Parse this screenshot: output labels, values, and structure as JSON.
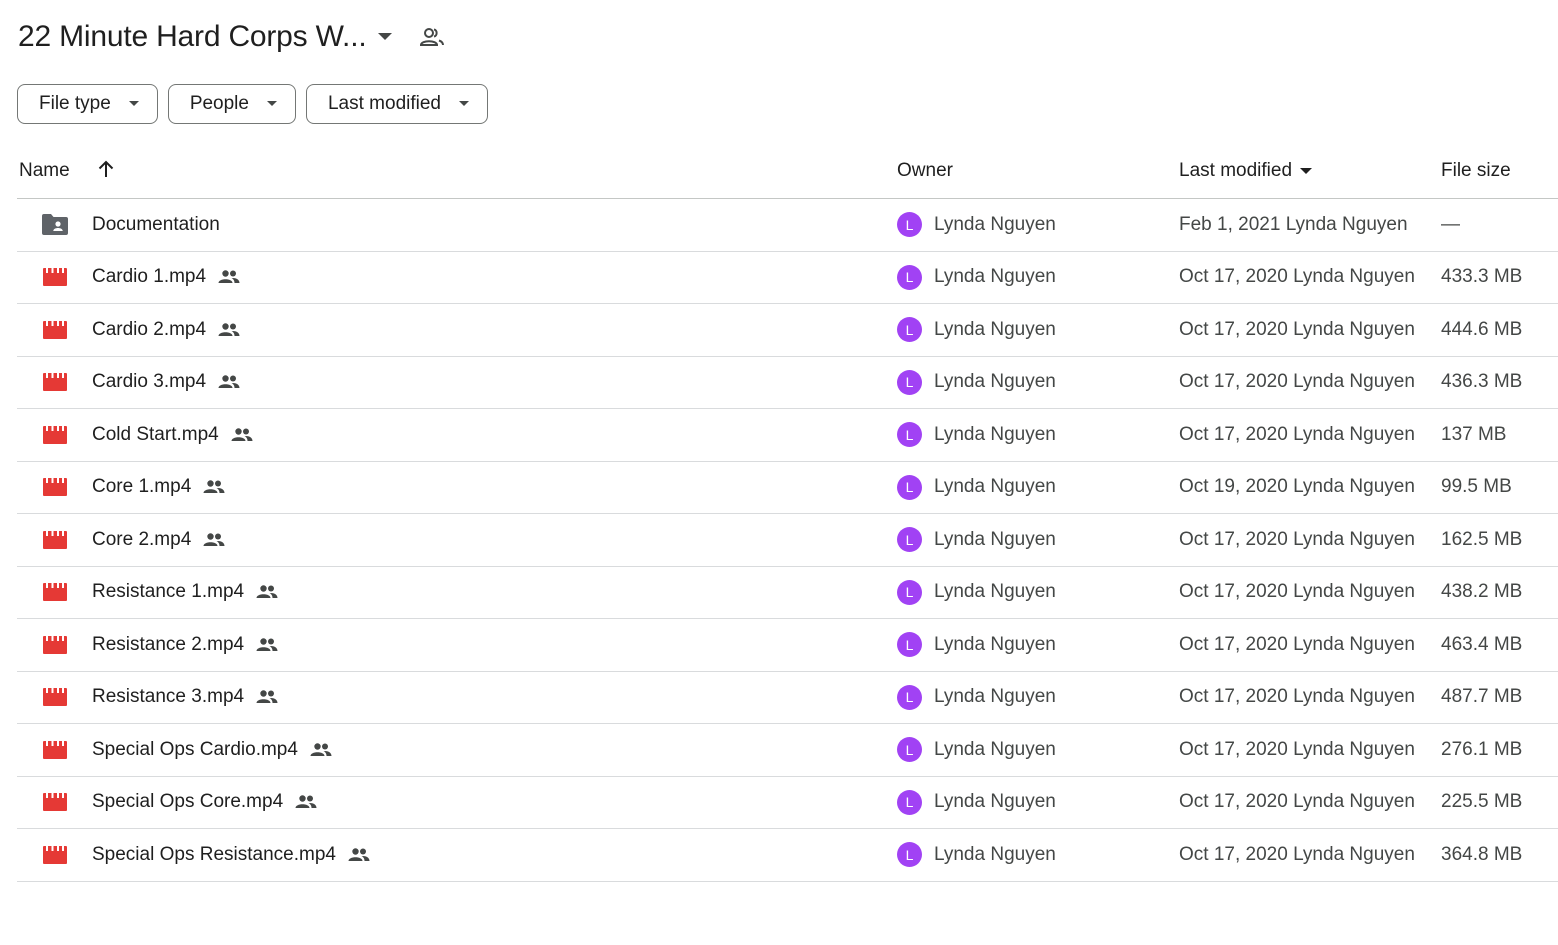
{
  "header": {
    "title": "22 Minute Hard Corps W..."
  },
  "filters": [
    {
      "label": "File type"
    },
    {
      "label": "People"
    },
    {
      "label": "Last modified"
    }
  ],
  "columns": {
    "name": "Name",
    "owner": "Owner",
    "last_modified": "Last modified",
    "file_size": "File size"
  },
  "colors": {
    "video_icon": "#e53935",
    "folder_icon": "#5f6368",
    "avatar": "#a142f4",
    "border": "#747775"
  },
  "files": [
    {
      "name": "Documentation",
      "type": "shared-folder",
      "shared": false,
      "owner": "Lynda Nguyen",
      "owner_initial": "L",
      "modified": "Feb 1, 2021 Lynda Nguyen",
      "size": "—"
    },
    {
      "name": "Cardio 1.mp4",
      "type": "video",
      "shared": true,
      "owner": "Lynda Nguyen",
      "owner_initial": "L",
      "modified": "Oct 17, 2020 Lynda Nguyen",
      "size": "433.3 MB"
    },
    {
      "name": "Cardio 2.mp4",
      "type": "video",
      "shared": true,
      "owner": "Lynda Nguyen",
      "owner_initial": "L",
      "modified": "Oct 17, 2020 Lynda Nguyen",
      "size": "444.6 MB"
    },
    {
      "name": "Cardio 3.mp4",
      "type": "video",
      "shared": true,
      "owner": "Lynda Nguyen",
      "owner_initial": "L",
      "modified": "Oct 17, 2020 Lynda Nguyen",
      "size": "436.3 MB"
    },
    {
      "name": "Cold Start.mp4",
      "type": "video",
      "shared": true,
      "owner": "Lynda Nguyen",
      "owner_initial": "L",
      "modified": "Oct 17, 2020 Lynda Nguyen",
      "size": "137 MB"
    },
    {
      "name": "Core 1.mp4",
      "type": "video",
      "shared": true,
      "owner": "Lynda Nguyen",
      "owner_initial": "L",
      "modified": "Oct 19, 2020 Lynda Nguyen",
      "size": "99.5 MB"
    },
    {
      "name": "Core 2.mp4",
      "type": "video",
      "shared": true,
      "owner": "Lynda Nguyen",
      "owner_initial": "L",
      "modified": "Oct 17, 2020 Lynda Nguyen",
      "size": "162.5 MB"
    },
    {
      "name": "Resistance 1.mp4",
      "type": "video",
      "shared": true,
      "owner": "Lynda Nguyen",
      "owner_initial": "L",
      "modified": "Oct 17, 2020 Lynda Nguyen",
      "size": "438.2 MB"
    },
    {
      "name": "Resistance 2.mp4",
      "type": "video",
      "shared": true,
      "owner": "Lynda Nguyen",
      "owner_initial": "L",
      "modified": "Oct 17, 2020 Lynda Nguyen",
      "size": "463.4 MB"
    },
    {
      "name": "Resistance 3.mp4",
      "type": "video",
      "shared": true,
      "owner": "Lynda Nguyen",
      "owner_initial": "L",
      "modified": "Oct 17, 2020 Lynda Nguyen",
      "size": "487.7 MB"
    },
    {
      "name": "Special Ops Cardio.mp4",
      "type": "video",
      "shared": true,
      "owner": "Lynda Nguyen",
      "owner_initial": "L",
      "modified": "Oct 17, 2020 Lynda Nguyen",
      "size": "276.1 MB"
    },
    {
      "name": "Special Ops Core.mp4",
      "type": "video",
      "shared": true,
      "owner": "Lynda Nguyen",
      "owner_initial": "L",
      "modified": "Oct 17, 2020 Lynda Nguyen",
      "size": "225.5 MB"
    },
    {
      "name": "Special Ops Resistance.mp4",
      "type": "video",
      "shared": true,
      "owner": "Lynda Nguyen",
      "owner_initial": "L",
      "modified": "Oct 17, 2020 Lynda Nguyen",
      "size": "364.8 MB"
    }
  ]
}
